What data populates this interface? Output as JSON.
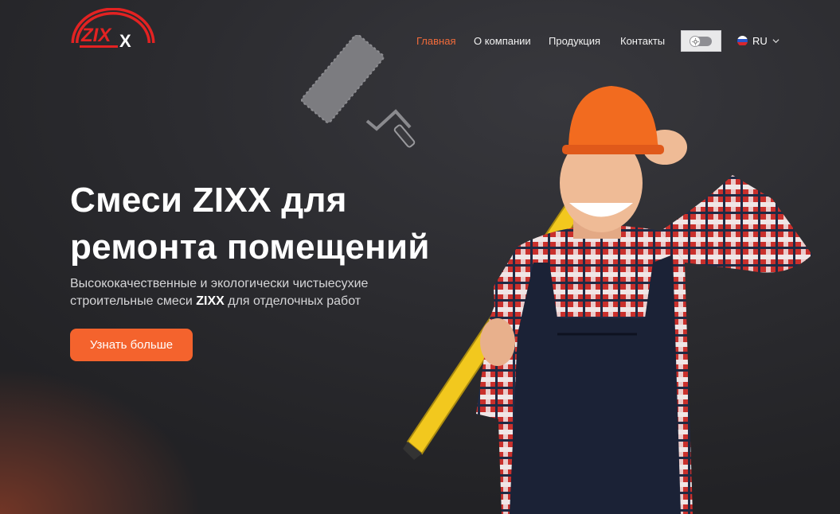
{
  "brand": {
    "logo_text": "ZIX",
    "logo_x": "X"
  },
  "nav": {
    "items": [
      {
        "label": "Главная",
        "active": true
      },
      {
        "label": "О компании",
        "active": false
      },
      {
        "label": "Продукция",
        "active": false
      },
      {
        "label": "Контакты",
        "active": false
      }
    ]
  },
  "language": {
    "code": "RU"
  },
  "hero": {
    "title_line1": "Смеси ZIXX для",
    "title_line2": "ремонта помещений",
    "subtitle_part1": "Высококачественные и экологически чистыесухие строительные смеси ",
    "subtitle_brand": "ZIXX",
    "subtitle_part2": " для отделочных работ",
    "cta_label": "Узнать больше"
  },
  "colors": {
    "accent": "#f4632d",
    "nav_active": "#f26b3a",
    "background": "#2a2a2e"
  },
  "icons": [
    "sun-icon",
    "russia-flag-icon",
    "chevron-down-icon",
    "paint-roller-icon"
  ]
}
